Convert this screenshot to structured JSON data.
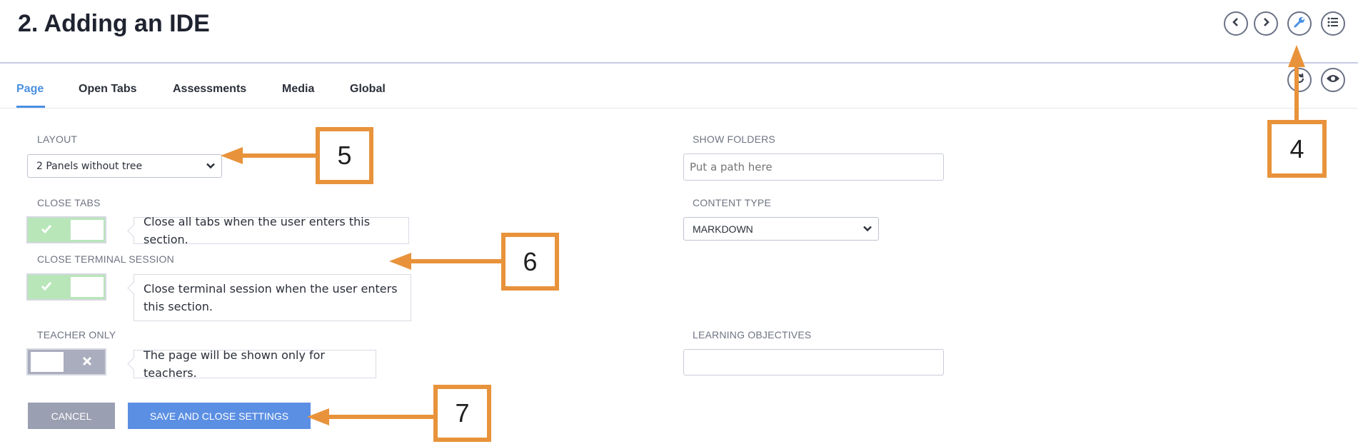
{
  "header": {
    "title": "2. Adding an IDE"
  },
  "toolbar_icons": [
    "chevron-left-icon",
    "chevron-right-icon",
    "wrench-icon",
    "list-icon",
    "refresh-icon",
    "eye-icon"
  ],
  "tabs": [
    {
      "label": "Page",
      "active": true
    },
    {
      "label": "Open Tabs",
      "active": false
    },
    {
      "label": "Assessments",
      "active": false
    },
    {
      "label": "Media",
      "active": false
    },
    {
      "label": "Global",
      "active": false
    }
  ],
  "form": {
    "layout": {
      "label": "LAYOUT",
      "value": "2 Panels without tree"
    },
    "close_tabs": {
      "label": "CLOSE TABS",
      "enabled": true,
      "help": "Close all tabs when the user enters this section."
    },
    "close_terminal": {
      "label": "CLOSE TERMINAL SESSION",
      "enabled": true,
      "help": "Close terminal session when the user enters this section."
    },
    "teacher_only": {
      "label": "TEACHER ONLY",
      "enabled": false,
      "help": "The page will be shown only for teachers."
    },
    "show_folders": {
      "label": "SHOW FOLDERS",
      "value": "",
      "placeholder": "Put a path here"
    },
    "content_type": {
      "label": "CONTENT TYPE",
      "value": "MARKDOWN"
    },
    "learning_objectives": {
      "label": "LEARNING OBJECTIVES",
      "value": ""
    }
  },
  "buttons": {
    "cancel": "CANCEL",
    "save": "SAVE AND CLOSE SETTINGS"
  },
  "callouts": {
    "c4": "4",
    "c5": "5",
    "c6": "6",
    "c7": "7"
  },
  "colors": {
    "accent": "#4a90e2",
    "annotation": "#e8933b",
    "toggle_on": "#b8e6b9",
    "toggle_off": "#a9adbd",
    "cancel": "#9a9fb1",
    "save": "#5b8fe3"
  }
}
